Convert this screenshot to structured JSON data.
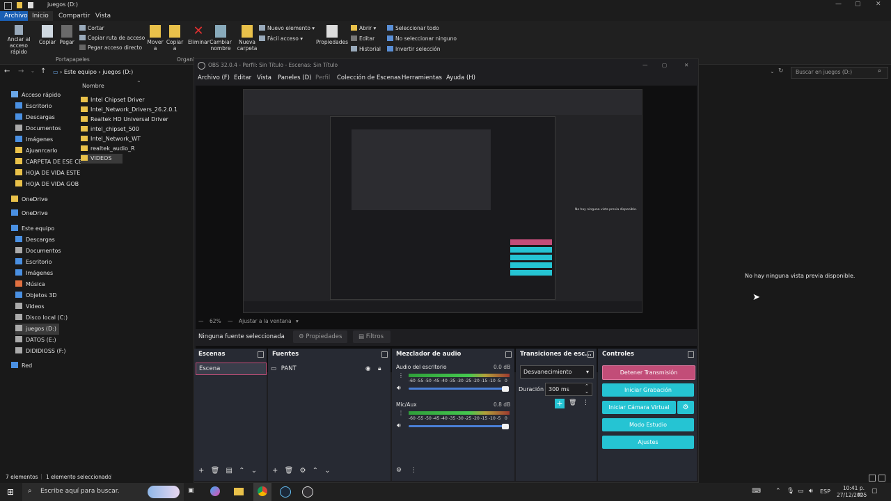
{
  "explorer": {
    "window_title": "juegos (D:)",
    "menu_tabs": [
      "Archivo",
      "Inicio",
      "Compartir",
      "Vista"
    ],
    "ribbon": {
      "anclar": "Anclar al acceso rápido",
      "copiar": "Copiar",
      "pegar": "Pegar",
      "cortar": "Cortar",
      "copiar_ruta": "Copiar ruta de acceso",
      "pegar_acceso": "Pegar acceso directo",
      "mover": "Mover a",
      "copiar_a": "Copiar a",
      "eliminar": "Eliminar",
      "cambiar_nombre": "Cambiar nombre",
      "nueva_carpeta": "Nueva carpeta",
      "nuevo_elemento": "Nuevo elemento",
      "facil_acceso": "Fácil acceso",
      "propiedades": "Propiedades",
      "abrir": "Abrir",
      "editar": "Editar",
      "historial": "Historial",
      "seleccionar_todo": "Seleccionar todo",
      "no_seleccionar": "No seleccionar ninguno",
      "invertir": "Invertir selección",
      "grupo_portapapeles": "Portapapeles",
      "grupo_organizar": "Organi"
    },
    "breadcrumb": [
      "Este equipo",
      "juegos (D:)"
    ],
    "search_placeholder": "Buscar en juegos (D:)",
    "column_name": "Nombre",
    "nav": [
      {
        "label": "Acceso rápido"
      },
      {
        "label": "Escritorio"
      },
      {
        "label": "Descargas"
      },
      {
        "label": "Documentos"
      },
      {
        "label": "Imágenes"
      },
      {
        "label": "Ajuanrcarlo"
      },
      {
        "label": "CARPETA DE ESE CE"
      },
      {
        "label": "HOJA DE VIDA ESTE"
      },
      {
        "label": "HOJA DE VIDA GOB"
      },
      {
        "label": "OneDrive"
      },
      {
        "label": "OneDrive"
      },
      {
        "label": "Este equipo"
      },
      {
        "label": "Descargas"
      },
      {
        "label": "Documentos"
      },
      {
        "label": "Escritorio"
      },
      {
        "label": "Imágenes"
      },
      {
        "label": "Música"
      },
      {
        "label": "Objetos 3D"
      },
      {
        "label": "Videos"
      },
      {
        "label": "Disco local (C:)"
      },
      {
        "label": "juegos (D:)"
      },
      {
        "label": "DATOS (E:)"
      },
      {
        "label": "DIDIDIOSS (F:)"
      },
      {
        "label": "Red"
      }
    ],
    "files": [
      "Intel Chipset Driver",
      "Intel_Network_Drivers_26.2.0.1",
      "Realtek HD Universal Driver",
      "intel_chipset_500",
      "Intel_Network_WT",
      "realtek_audio_R",
      "VIDEOS"
    ],
    "status_count": "7 elementos",
    "status_selected": "1 elemento seleccionado"
  },
  "obs": {
    "title": "OBS 32.0.4 - Perfil: Sin Título - Escenas: Sin Título",
    "menu": [
      "Archivo (F)",
      "Editar",
      "Vista",
      "Paneles (D)",
      "Perfil",
      "Colección de Escenas",
      "Herramientas",
      "Ayuda (H)"
    ],
    "zoom": "62%",
    "fit_label": "Ajustar a la ventana",
    "no_source": "Ninguna fuente seleccionada",
    "properties": "Propiedades",
    "filters": "Filtros",
    "scenes_title": "Escenas",
    "scene_item": "Escena",
    "sources_title": "Fuentes",
    "source_item": "PANT",
    "mixer_title": "Mezclador de audio",
    "mixer": [
      {
        "name": "Audio del escritorio",
        "db": "0.0 dB"
      },
      {
        "name": "Mic/Aux",
        "db": "0.8 dB"
      }
    ],
    "meter_ticks": [
      "-60",
      "-55",
      "-50",
      "-45",
      "-40",
      "-35",
      "-30",
      "-25",
      "-20",
      "-15",
      "-10",
      "-5",
      "0"
    ],
    "transitions_title": "Transiciones de esc...",
    "transition_value": "Desvanecimiento",
    "duration_label": "Duración",
    "duration_value": "300 ms",
    "controls_title": "Controles",
    "controls": {
      "stop_stream": "Detener Transmisión",
      "start_record": "Iniciar Grabación",
      "virtual_cam": "Iniciar Cámara Virtual",
      "studio": "Modo Estudio",
      "settings": "Ajustes"
    },
    "inner_no_preview": "No hay ninguna vista previa disponible."
  },
  "desktop_no_preview": "No hay ninguna vista previa disponible.",
  "taskbar": {
    "search_placeholder": "Escribe aquí para buscar.",
    "lang": "ESP",
    "time": "10:41 p. m.",
    "date": "27/12/2025"
  },
  "colors": {
    "accent_cyan": "#25c4d3",
    "accent_pink": "#c24d78",
    "folder": "#e9c14a"
  }
}
